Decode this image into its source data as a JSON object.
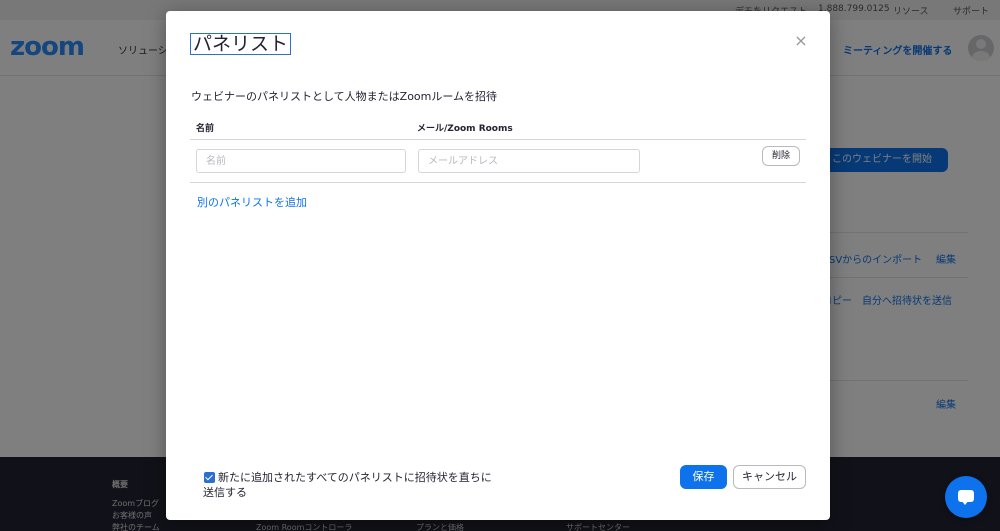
{
  "topbar": {
    "demo": "デモをリクエスト",
    "phone": "1.888.799.0125",
    "resources": "リソース",
    "support": "サポート"
  },
  "header": {
    "logo": "zoom",
    "solutions": "ソリューション",
    "host_meeting": "ミーティングを開催する"
  },
  "background": {
    "start_webinar": "このウェビナーを開始",
    "import_link": "CSVからのインポート",
    "edit_1": "編集",
    "copy_link": "コピー",
    "send_invite_self": "自分へ招待状を送信",
    "edit_2": "編集"
  },
  "footer": {
    "about": "概要",
    "blog": "Zoomブログ",
    "customers": "お客様の声",
    "team": "弊社のチーム",
    "rooms_controller": "Zoom Roomコントローラ",
    "plans": "プランと価格",
    "support_center": "サポートセンター"
  },
  "modal": {
    "title": "パネリスト",
    "close_symbol": "×",
    "description": "ウェビナーのパネリストとして人物またはZoomルームを招待",
    "col_name": "名前",
    "col_email": "メール/Zoom Rooms",
    "rows": [
      {
        "name_value": "",
        "name_placeholder": "名前",
        "email_value": "",
        "email_placeholder": "メールアドレス",
        "delete_label": "削除"
      }
    ],
    "add_panelist": "別のパネリストを追加",
    "send_invite_checkbox": "新たに追加されたすべてのパネリストに招待状を直ちに送信する",
    "send_invite_checked": true,
    "save_label": "保存",
    "cancel_label": "キャンセル"
  },
  "colors": {
    "accent": "#0e72ed",
    "overlay": "rgba(0,0,0,0.5)",
    "footer_bg": "#232333"
  },
  "icons": {
    "close": "close-icon",
    "checkbox": "checkbox-checked-icon",
    "chat": "chat-bubble-icon",
    "avatar": "user-avatar-icon"
  }
}
